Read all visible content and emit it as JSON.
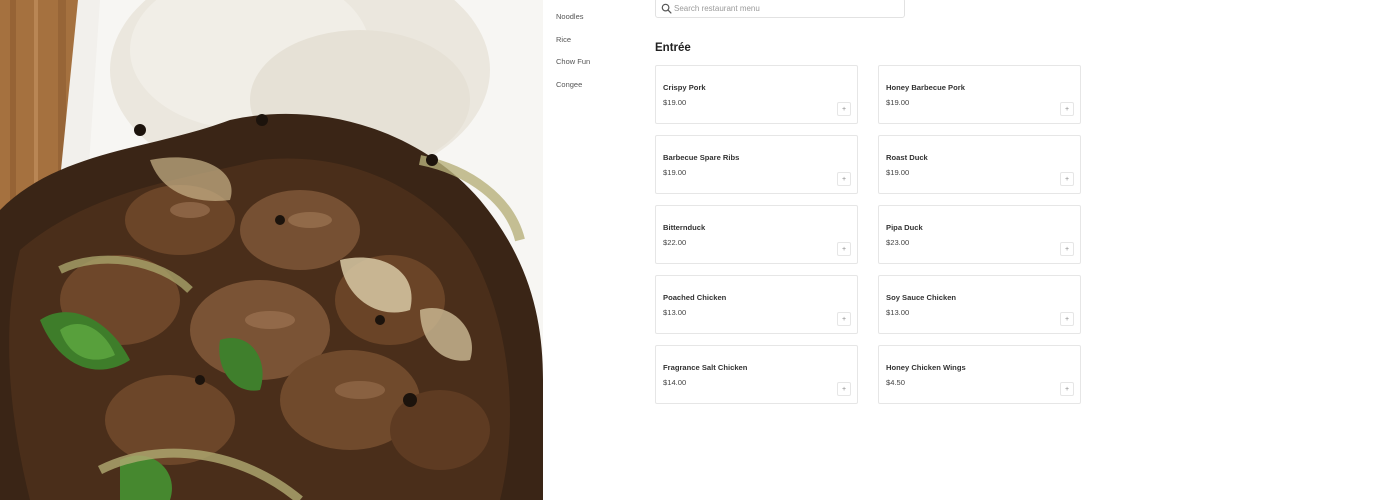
{
  "categories": [
    "Noodles",
    "Rice",
    "Chow Fun",
    "Congee"
  ],
  "search": {
    "placeholder": "Search restaurant menu",
    "value": ""
  },
  "section": {
    "title": "Entrée"
  },
  "menu_items": [
    {
      "name": "Crispy Pork",
      "price": "$19.00"
    },
    {
      "name": "Honey Barbecue Pork",
      "price": "$19.00"
    },
    {
      "name": "Barbecue Spare Ribs",
      "price": "$19.00"
    },
    {
      "name": "Roast Duck",
      "price": "$19.00"
    },
    {
      "name": "Bitternduck",
      "price": "$22.00"
    },
    {
      "name": "Pipa Duck",
      "price": "$23.00"
    },
    {
      "name": "Poached Chicken",
      "price": "$13.00"
    },
    {
      "name": "Soy Sauce Chicken",
      "price": "$13.00"
    },
    {
      "name": "Fragrance Salt Chicken",
      "price": "$14.00"
    },
    {
      "name": "Honey Chicken Wings",
      "price": "$4.50"
    }
  ],
  "add_symbol": "+",
  "icons": {
    "search": "search-icon",
    "add": "plus-icon"
  },
  "colors": {
    "card_border": "#e6e6e6",
    "text": "#333333",
    "muted": "#9a9a9a"
  }
}
